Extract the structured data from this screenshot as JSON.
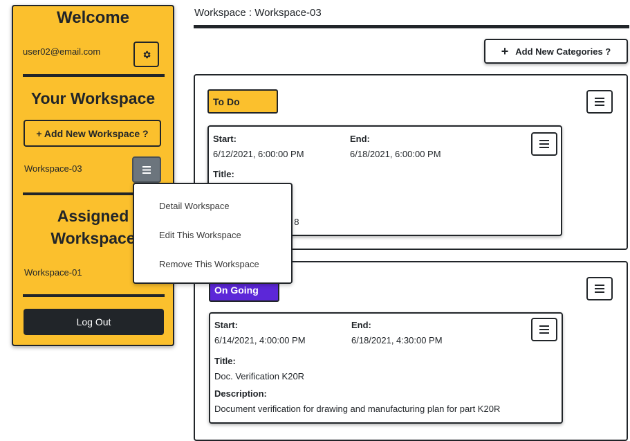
{
  "sidebar": {
    "welcome": "Welcome",
    "user_email": "user02@email.com",
    "your_workspace_title": "Your Workspace",
    "add_workspace_label": "+ Add New Workspace ?",
    "workspaces": [
      "Workspace-03"
    ],
    "assigned_title_line1": "Assigned",
    "assigned_title_line2": "Workspace",
    "assigned_workspaces": [
      "Workspace-01"
    ],
    "logout_label": "Log Out",
    "accent_color": "#fbc02d"
  },
  "dropdown": {
    "items": [
      "Detail Workspace",
      "Edit This Workspace",
      "Remove This Workspace"
    ]
  },
  "header": {
    "title": "Workspace : Workspace-03",
    "add_category_label": "Add New Categories ?"
  },
  "categories": [
    {
      "name": "To Do",
      "color": "#fbc02d",
      "task": {
        "start_label": "Start:",
        "start": "6/12/2021, 6:00:00 PM",
        "end_label": "End:",
        "end": "6/18/2021, 6:00:00 PM",
        "title_label": "Title:",
        "partial_text": "t 8"
      }
    },
    {
      "name": "On Going",
      "color": "#5c27d8",
      "task": {
        "start_label": "Start:",
        "start": "6/14/2021, 4:00:00 PM",
        "end_label": "End:",
        "end": "6/18/2021, 4:30:00 PM",
        "title_label": "Title:",
        "title": "Doc. Verification K20R",
        "description_label": "Description:",
        "description": "Document verification for drawing and manufacturing plan for part K20R"
      }
    }
  ]
}
